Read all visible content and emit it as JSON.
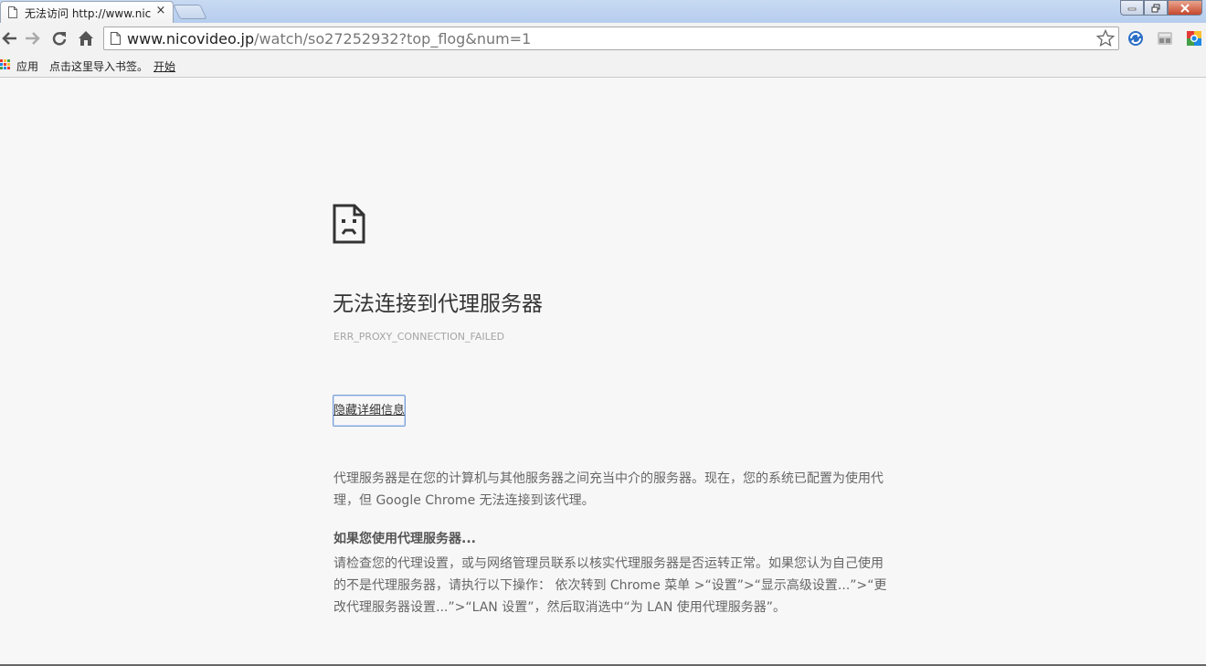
{
  "tab": {
    "title": "无法访问 http://www.nic",
    "close": "×"
  },
  "toolbar": {
    "url_host": "www.nicovideo.jp",
    "url_path": "/watch/so27252932?top_flog&num=1"
  },
  "bookmarks": {
    "apps_label": "应用",
    "import_label": "点击这里导入书签。",
    "start_label": "开始"
  },
  "error": {
    "title": "无法连接到代理服务器",
    "code": "ERR_PROXY_CONNECTION_FAILED",
    "details_button": "隐藏详细信息",
    "paragraph1": "代理服务器是在您的计算机与其他服务器之间充当中介的服务器。现在，您的系统已配置为使用代理，但 Google Chrome 无法连接到该代理。",
    "subheading": "如果您使用代理服务器...",
    "paragraph2": "请检查您的代理设置，或与网络管理员联系以核实代理服务器是否运转正常。如果您认为自己使用的不是代理服务器，请执行以下操作： 依次转到 Chrome 菜单 >“设置”>“显示高级设置...”>“更改代理服务器设置...”>“LAN 设置”，然后取消选中“为 LAN 使用代理服务器”。"
  },
  "icons": {
    "tab_page": "page-icon",
    "back": "back-arrow-icon",
    "forward": "forward-arrow-icon",
    "reload": "reload-icon",
    "home": "home-icon",
    "star": "star-icon",
    "error": "sad-page-icon"
  },
  "colors": {
    "tabstrip": "#b5cdee",
    "content_bg": "#f7f7f7",
    "button_border": "#7aa0d8"
  }
}
